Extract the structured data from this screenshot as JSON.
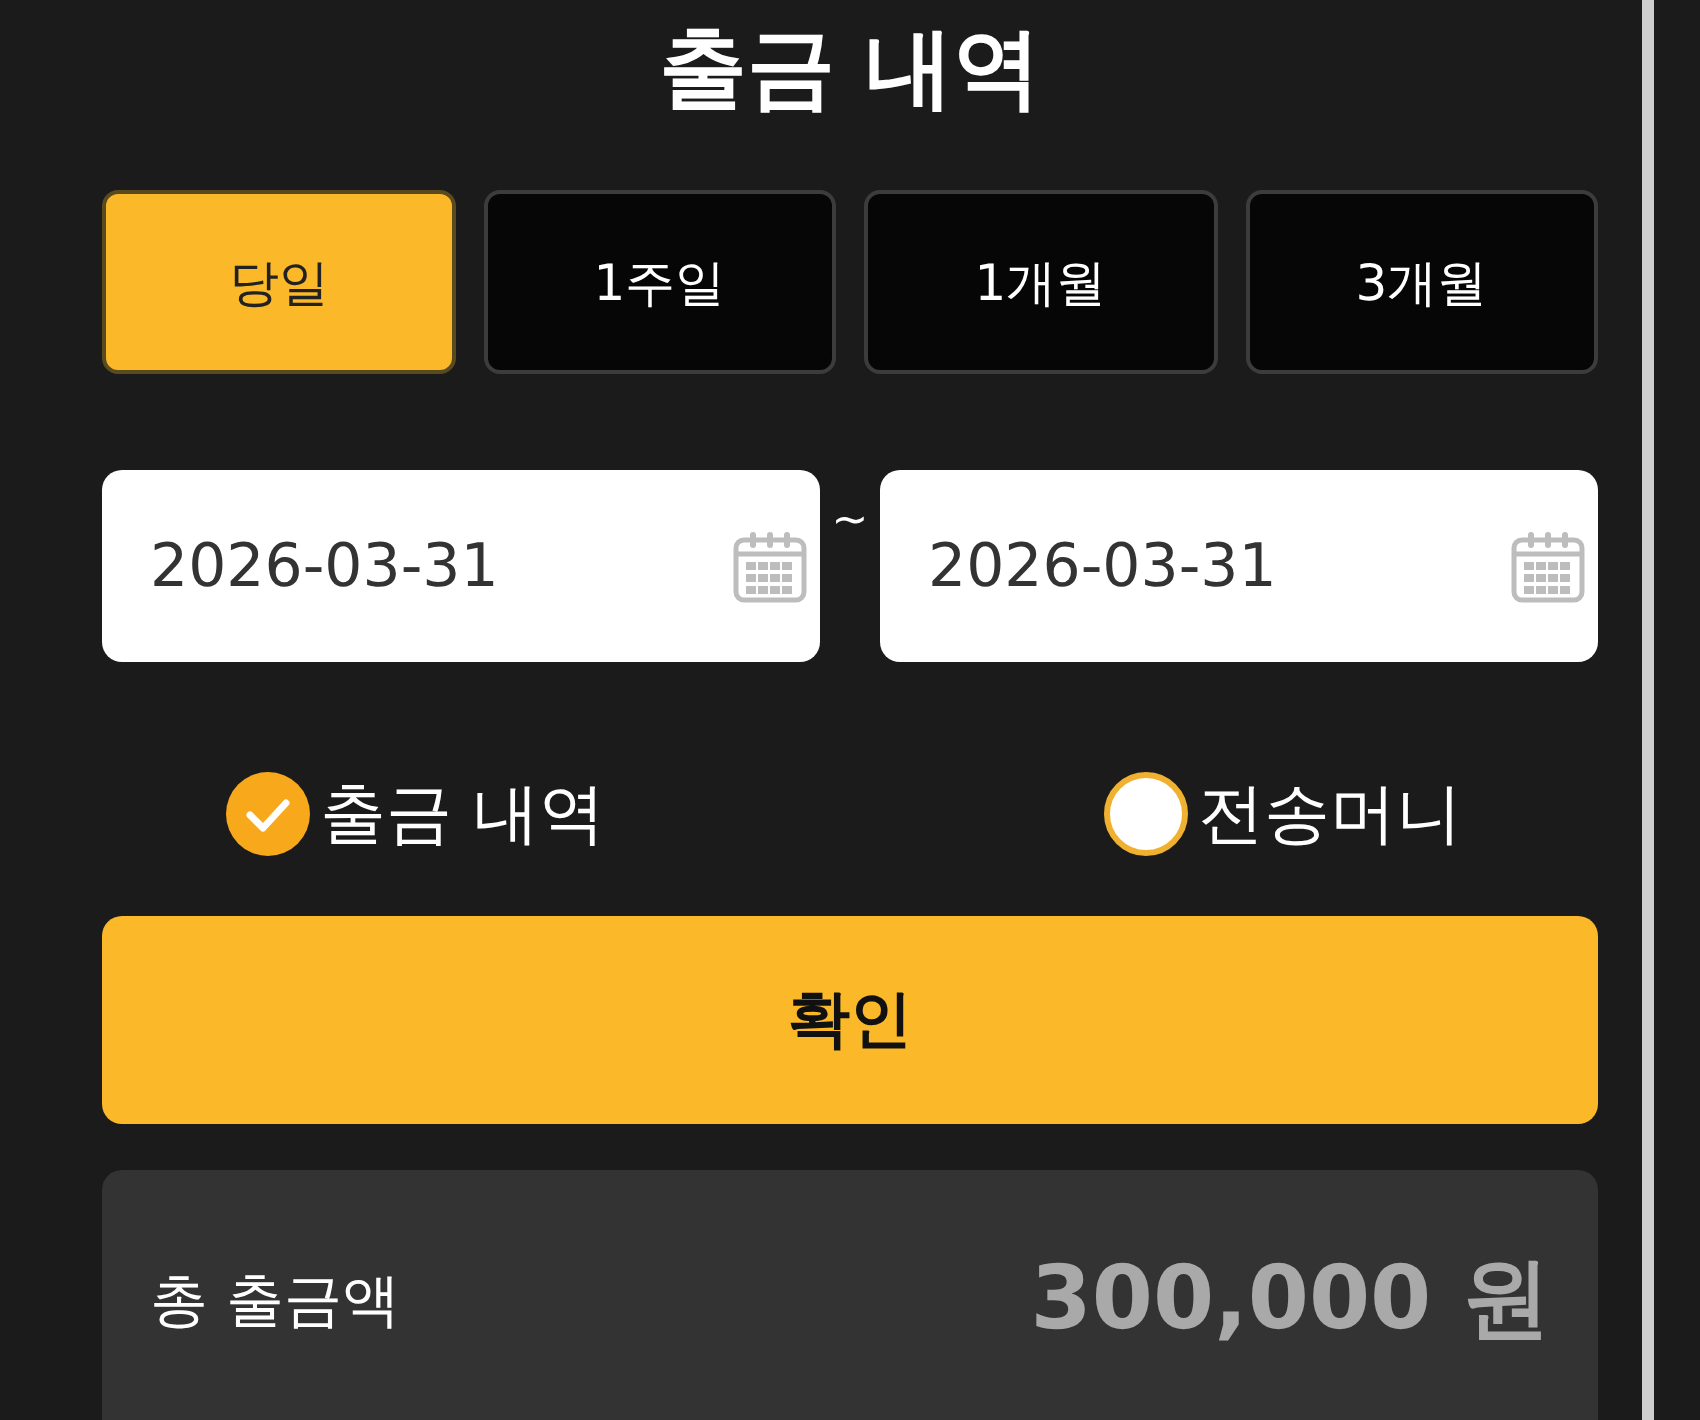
{
  "title": "출금 내역",
  "period_tabs": [
    {
      "label": "당일",
      "selected": true
    },
    {
      "label": "1주일",
      "selected": false
    },
    {
      "label": "1개월",
      "selected": false
    },
    {
      "label": "3개월",
      "selected": false
    }
  ],
  "date_range": {
    "start": "2026-03-31",
    "separator": "~",
    "end": "2026-03-31"
  },
  "record_types": [
    {
      "label": "출금 내역",
      "selected": true
    },
    {
      "label": "전송머니",
      "selected": false
    }
  ],
  "confirm_button": "확인",
  "summary": {
    "label": "총 출금액",
    "amount": "300,000 원"
  }
}
